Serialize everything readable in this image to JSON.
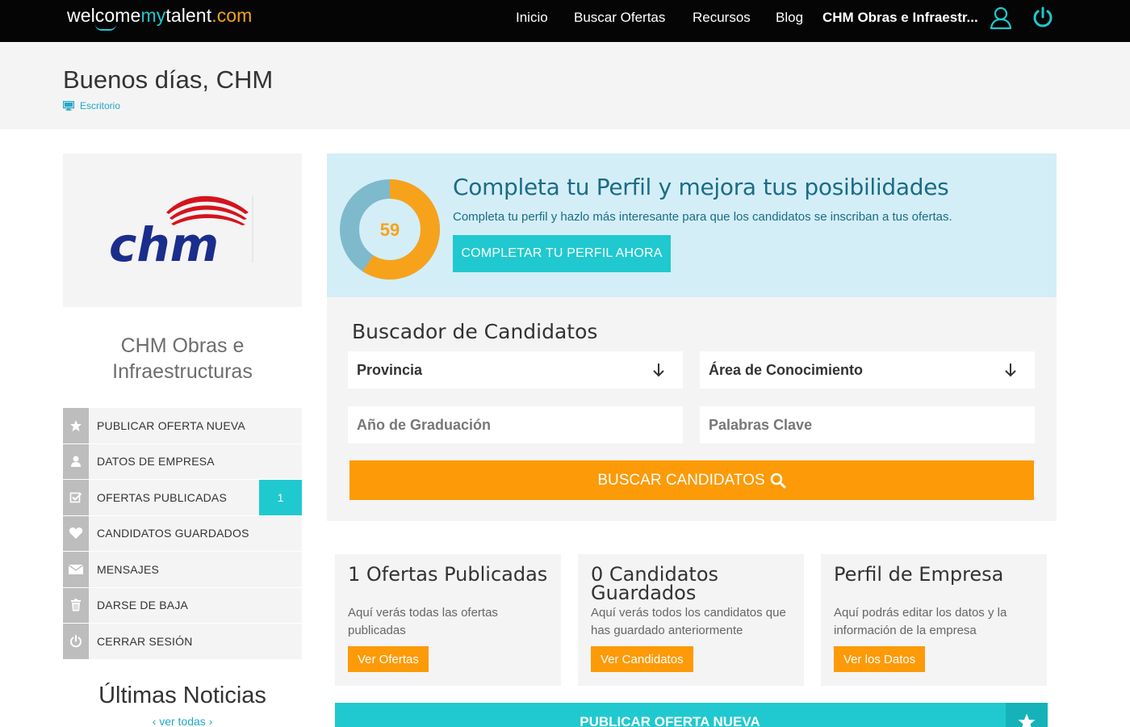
{
  "nav": {
    "logo": {
      "part1": "welcome",
      "part2": "my",
      "part3": "talent",
      "part4": ".com"
    },
    "links": [
      {
        "label": "Inicio"
      },
      {
        "label": "Buscar Ofertas"
      },
      {
        "label": "Recursos"
      },
      {
        "label": "Blog"
      },
      {
        "label": "CHM Obras e Infraestr..."
      }
    ],
    "icons": [
      "user-icon",
      "power-icon"
    ]
  },
  "header": {
    "greeting": "Buenos días, CHM",
    "breadcrumb": "Escritorio",
    "breadcrumb_icon": "monitor-icon"
  },
  "sidebar": {
    "logo_text": "chm",
    "company_name_line1": "CHM Obras e",
    "company_name_line2": "Infraestructuras",
    "menu": [
      {
        "label": "PUBLICAR OFERTA NUEVA",
        "icon": "star-icon"
      },
      {
        "label": "DATOS DE EMPRESA",
        "icon": "person-icon"
      },
      {
        "label": "OFERTAS PUBLICADAS",
        "icon": "checkbox-icon",
        "badge": "1"
      },
      {
        "label": "CANDIDATOS GUARDADOS",
        "icon": "heart-icon"
      },
      {
        "label": "MENSAJES",
        "icon": "envelope-icon"
      },
      {
        "label": "DARSE DE BAJA",
        "icon": "trash-icon"
      },
      {
        "label": "CERRAR SESIÓN",
        "icon": "power-icon"
      }
    ],
    "news_title": "Últimas Noticias",
    "news_link": "ver todas"
  },
  "profile": {
    "completion": 59,
    "completion_label": "59",
    "title": "Completa tu Perfil y mejora tus posibilidades",
    "subtitle": "Completa tu perfil y hazlo más interesante para que los candidatos se inscriban a tus ofertas.",
    "button": "COMPLETAR TU PERFIL AHORA",
    "colors": {
      "progress": "#f7a21b",
      "remaining": "#7fb9cc"
    }
  },
  "search": {
    "title": "Buscador de Candidatos",
    "provincia": "Provincia",
    "area": "Área de Conocimiento",
    "graduacion_placeholder": "Año de Graduación",
    "palabras_placeholder": "Palabras Clave",
    "button": "BUSCAR CANDIDATOS"
  },
  "cards": [
    {
      "title": "1 Ofertas Publicadas",
      "text": "Aquí verás todas las ofertas publicadas",
      "button": "Ver Ofertas"
    },
    {
      "title": "0 Candidatos Guardados",
      "text": "Aquí verás todos los candidatos que has guardado anteriormente",
      "button": "Ver Candidatos"
    },
    {
      "title": "Perfil de Empresa",
      "text": "Aquí podrás editar los datos y la información de la empresa",
      "button": "Ver los Datos"
    }
  ],
  "bottom_banner": {
    "label": "PUBLICAR OFERTA NUEVA",
    "icon": "star-icon"
  },
  "colors": {
    "accent": "#1fc9cf",
    "orange": "#fc9a08",
    "nav_bg": "#050505",
    "panel_bg": "#f4f4f4",
    "profile_bg": "#d4eef7"
  }
}
